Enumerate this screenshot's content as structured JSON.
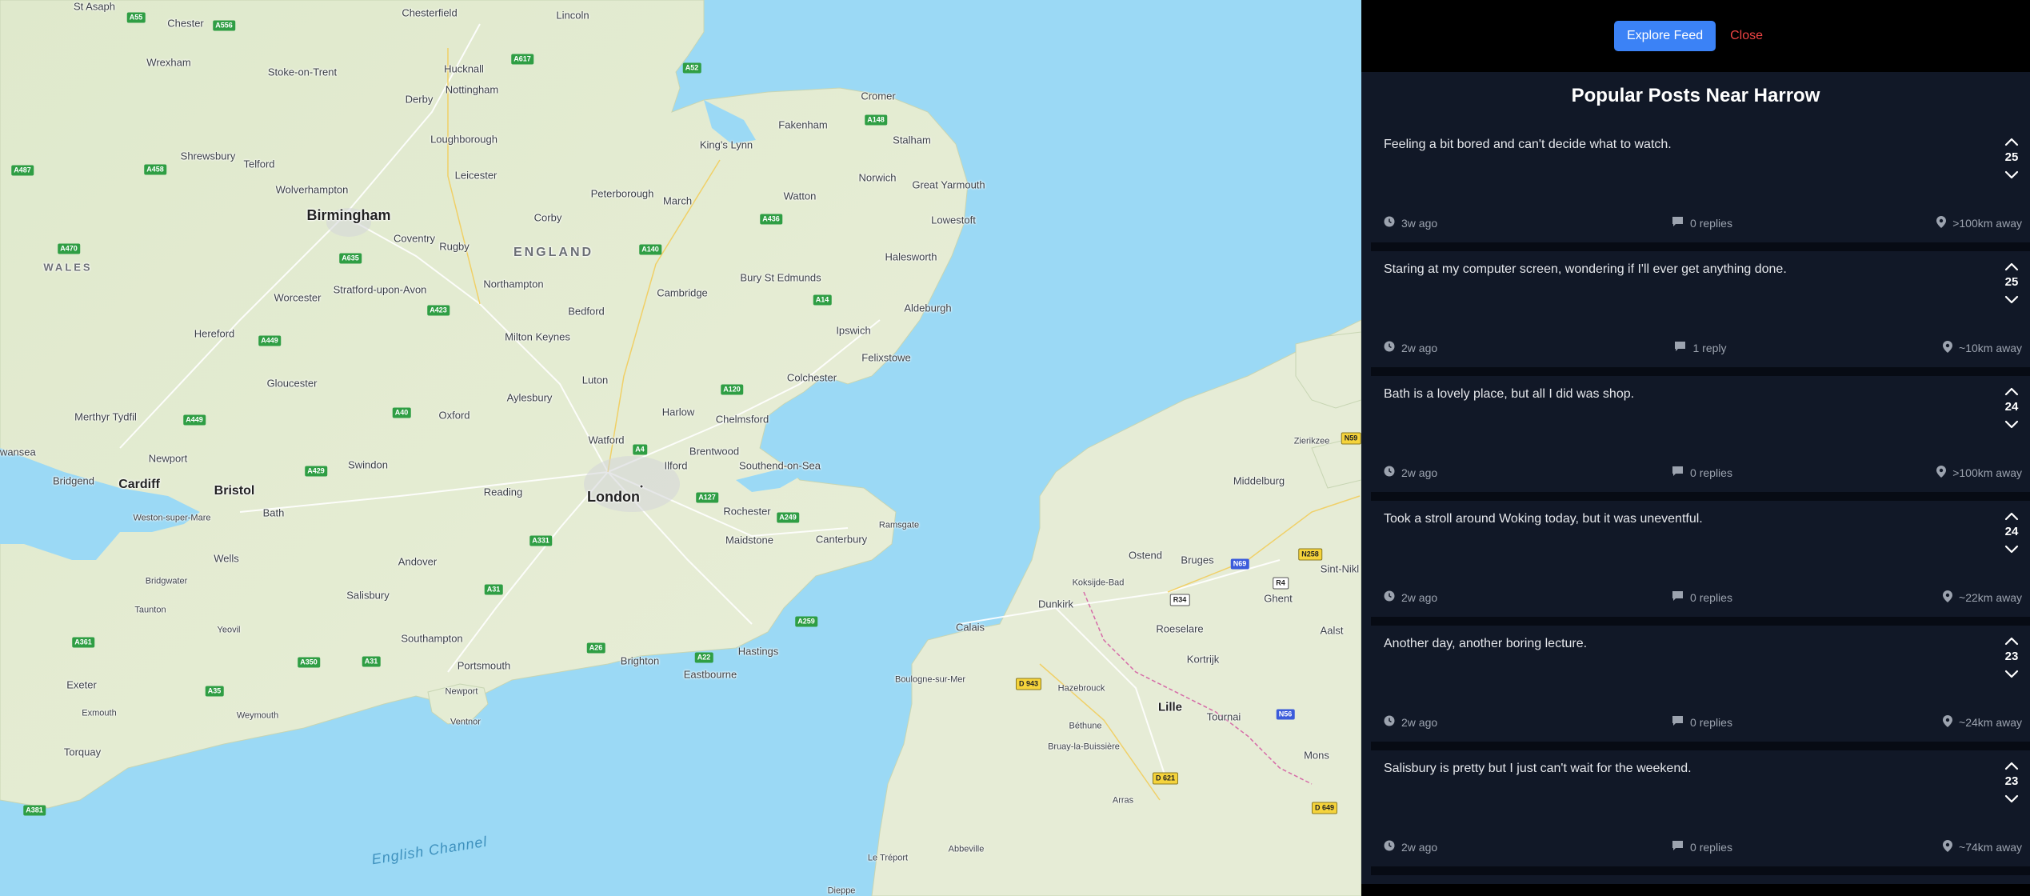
{
  "map": {
    "colors": {
      "water": "#9bd9f5",
      "land": "#e6ecd4",
      "marker": "#2aa5bb"
    },
    "labels": {
      "cities": [
        "St Asaph",
        "Chester",
        "Chesterfield",
        "Lincoln",
        "Wrexham",
        "Stoke-on-Trent",
        "Hucknall",
        "Nottingham",
        "Derby",
        "Cromer",
        "Fakenham",
        "Stalham",
        "King's Lynn",
        "Shrewsbury",
        "Telford",
        "Loughborough",
        "Leicester",
        "Norwich",
        "Great Yarmouth",
        "Wolverhampton",
        "Peterborough",
        "March",
        "Watton",
        "Corby",
        "Coventry",
        "Rugby",
        "Lowestoft",
        "Halesworth",
        "Stratford-upon-Avon",
        "Northampton",
        "Bury St Edmunds",
        "Worcester",
        "Bedford",
        "Cambridge",
        "Aldeburgh",
        "Hereford",
        "Milton Keynes",
        "Ipswich",
        "Felixstowe",
        "Gloucester",
        "Luton",
        "Colchester",
        "Aylesbury",
        "Merthyr Tydfil",
        "Oxford",
        "Harlow",
        "Chelmsford",
        "Watford",
        "Brentwood",
        "Swansea",
        "Newport",
        "Swindon",
        "Ilford",
        "Southend-on-Sea",
        "Bridgend",
        "Reading",
        "Rochester",
        "Maidstone",
        "Ramsgate",
        "Weston-super-Mare",
        "Bath",
        "Canterbury",
        "Wells",
        "Andover",
        "Salisbury",
        "Bridgwater",
        "Taunton",
        "Yeovil",
        "Southampton",
        "Hastings",
        "Brighton",
        "Eastbourne",
        "Portsmouth",
        "Newport",
        "Exeter",
        "Exmouth",
        "Weymouth",
        "Ventnor",
        "Torquay",
        "Calais",
        "Dunkirk",
        "Koksijde-Bad",
        "Ostend",
        "Bruges",
        "Ghent",
        "Roeselare",
        "Kortrijk",
        "Lille",
        "Tournai",
        "Boulogne-sur-Mer",
        "Hazebrouck",
        "Béthune",
        "Bruay-la-Buissière",
        "Arras",
        "Abbeville",
        "Le Tréport",
        "Dieppe",
        "Middelburg",
        "Zierikzee",
        "Mons",
        "Sint-Nikl",
        "Aalst"
      ],
      "major": [
        "Birmingham",
        "Cardiff",
        "Bristol",
        "London"
      ],
      "regions": [
        "ENGLAND",
        "WALES"
      ],
      "sea": "English Channel",
      "roads": [
        "A55",
        "A556",
        "A617",
        "A52",
        "A148",
        "A487",
        "A458",
        "A470",
        "A635",
        "A140",
        "A14",
        "A436",
        "A449",
        "A423",
        "A120",
        "A40",
        "A449",
        "A429",
        "A4",
        "A127",
        "A249",
        "A331",
        "A31",
        "A259",
        "A26",
        "A22",
        "A350",
        "A31",
        "A35",
        "A361",
        "A381",
        "D 943",
        "N69",
        "R4",
        "N258",
        "R34",
        "N56",
        "D 621",
        "D 649",
        "N59"
      ]
    }
  },
  "panel": {
    "explore_label": "Explore Feed",
    "close_label": "Close",
    "title": "Popular Posts Near Harrow",
    "posts": [
      {
        "text": "Feeling a bit bored and can't decide what to watch.",
        "votes": "25",
        "time": "3w ago",
        "replies": "0 replies",
        "distance": ">100km away"
      },
      {
        "text": "Staring at my computer screen, wondering if I'll ever get anything done.",
        "votes": "25",
        "time": "2w ago",
        "replies": "1 reply",
        "distance": "~10km away"
      },
      {
        "text": "Bath is a lovely place, but all I did was shop.",
        "votes": "24",
        "time": "2w ago",
        "replies": "0 replies",
        "distance": ">100km away"
      },
      {
        "text": "Took a stroll around Woking today, but it was uneventful.",
        "votes": "24",
        "time": "2w ago",
        "replies": "0 replies",
        "distance": "~22km away"
      },
      {
        "text": "Another day, another boring lecture.",
        "votes": "23",
        "time": "2w ago",
        "replies": "0 replies",
        "distance": "~24km away"
      },
      {
        "text": "Salisbury is pretty but I just can't wait for the weekend.",
        "votes": "23",
        "time": "2w ago",
        "replies": "0 replies",
        "distance": "~74km away"
      }
    ]
  }
}
